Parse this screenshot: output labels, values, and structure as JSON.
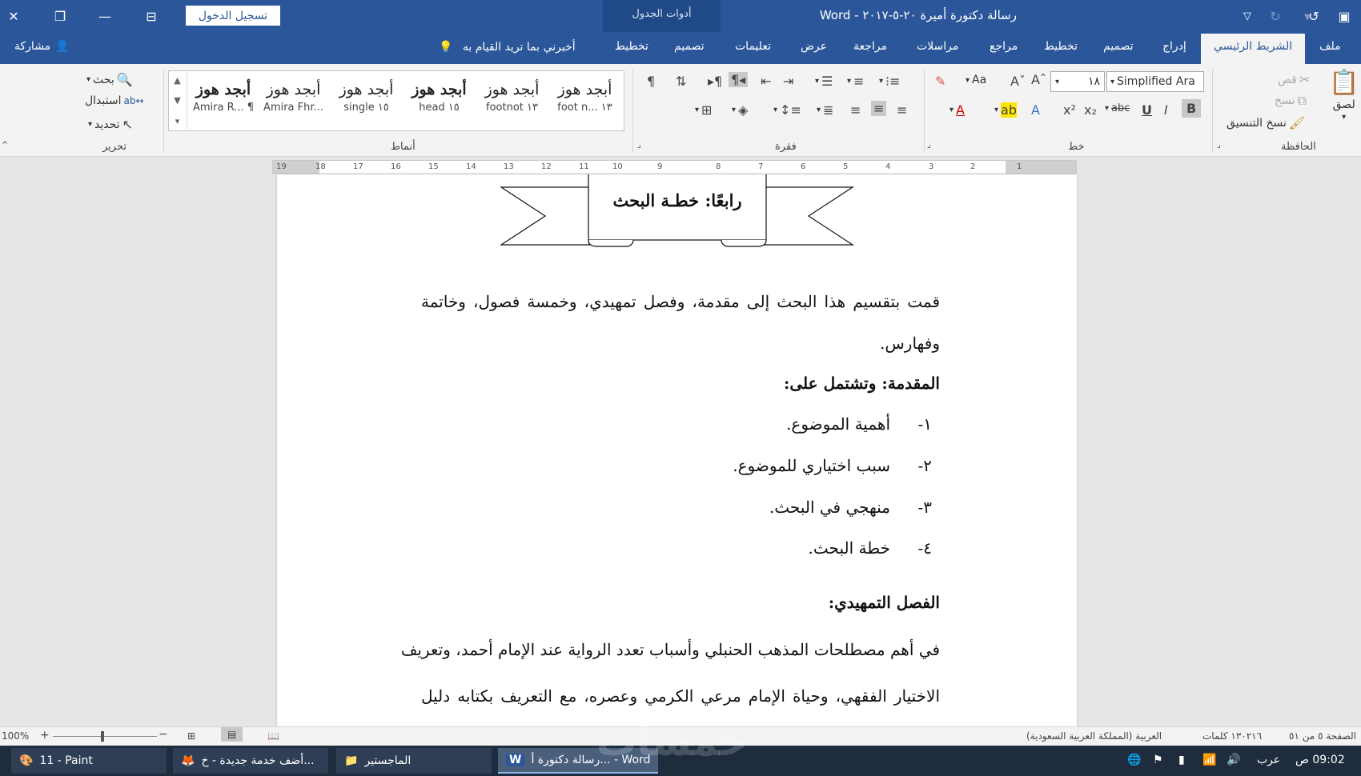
{
  "window": {
    "title": "رسالة دكتورة أميرة ٢٠-٥-٢٠١٧  -  Word",
    "signin": "تسجيل الدخول",
    "context_group": "أدوات الجدول"
  },
  "tabs": [
    "ملف",
    "الشريط الرئيسي",
    "إدراج",
    "تصميم",
    "تخطيط",
    "مراجع",
    "مراسلات",
    "مراجعة",
    "عرض",
    "تعليمات",
    "تصميم",
    "تخطيط"
  ],
  "tellme": "أخبرني بما تريد القيام به",
  "share": "مشاركة",
  "ribbon": {
    "clipboard": {
      "paste": "لصق",
      "cut": "قص",
      "copy": "نسخ",
      "format_painter": "نسخ التنسيق",
      "label": "الحافظة"
    },
    "font": {
      "name": "Simplified Ara",
      "size": "١٨",
      "label": "خط",
      "aa": "Aa"
    },
    "paragraph": {
      "label": "فقرة"
    },
    "styles": {
      "label": "أنماط",
      "items": [
        {
          "sample": "أبجد هوز",
          "name": "foot n... ١٣"
        },
        {
          "sample": "أبجد هوز",
          "name": "footnot ١٣"
        },
        {
          "sample": "أبجد هوز",
          "name": "head ١٥"
        },
        {
          "sample": "أبجد هوز",
          "name": "single ١٥"
        },
        {
          "sample": "أبجد هوز",
          "name": "Amira Fhr..."
        },
        {
          "sample": "أبجد هوز",
          "name": "Amira R... ¶"
        }
      ]
    },
    "editing": {
      "find": "بحث",
      "replace": "استبدال",
      "select": "تحديد",
      "label": "تحرير"
    }
  },
  "document": {
    "banner": "رابعًا: خطـة البحث",
    "para1_line1": "قمت بتقسيم هذا البحث إلى مقدمة، وفصل تمهيدي، وخمسة فصول، وخاتمة",
    "para1_line2": "وفهارس.",
    "heading1": "المقدمة: وتشتمل على:",
    "list": [
      {
        "num": "١-",
        "text": "أهمية الموضوع."
      },
      {
        "num": "٢-",
        "text": "سبب اختياري للموضوع."
      },
      {
        "num": "٣-",
        "text": "منهجي في البحث."
      },
      {
        "num": "٤-",
        "text": "خطة البحث."
      }
    ],
    "heading2": "الفصل التمهيدي:",
    "para2_line1": "في أهم مصطلحات المذهب الحنبلي وأسباب تعدد الرواية عند الإمام أحمد، وتعريف",
    "para2_line2": "الاختيار الفقهي، وحياة الإمام مرعي الكرمي وعصره، مع التعريف بكتابه دليل"
  },
  "status": {
    "page": "الصفحة ٥ من ٥١",
    "words": "١٣٠٢١٦ كلمات",
    "language": "العربية (المملكة العربية السعودية)",
    "zoom": "100%"
  },
  "taskbar": {
    "items": [
      {
        "label": "11 - Paint"
      },
      {
        "label": "أضف خدمة جديدة - خ..."
      },
      {
        "label": "الماجستير"
      },
      {
        "label": "رسالة دكتورة أ... - Word"
      }
    ],
    "lang": "عرب",
    "time": "09:02 ص"
  },
  "watermark": "خمسات",
  "ruler": {
    "numbers": [
      "1",
      "2",
      "3",
      "4",
      "5",
      "6",
      "7",
      "8",
      "9",
      "10",
      "11",
      "12",
      "13",
      "14",
      "15",
      "16",
      "17",
      "18",
      "19"
    ]
  }
}
